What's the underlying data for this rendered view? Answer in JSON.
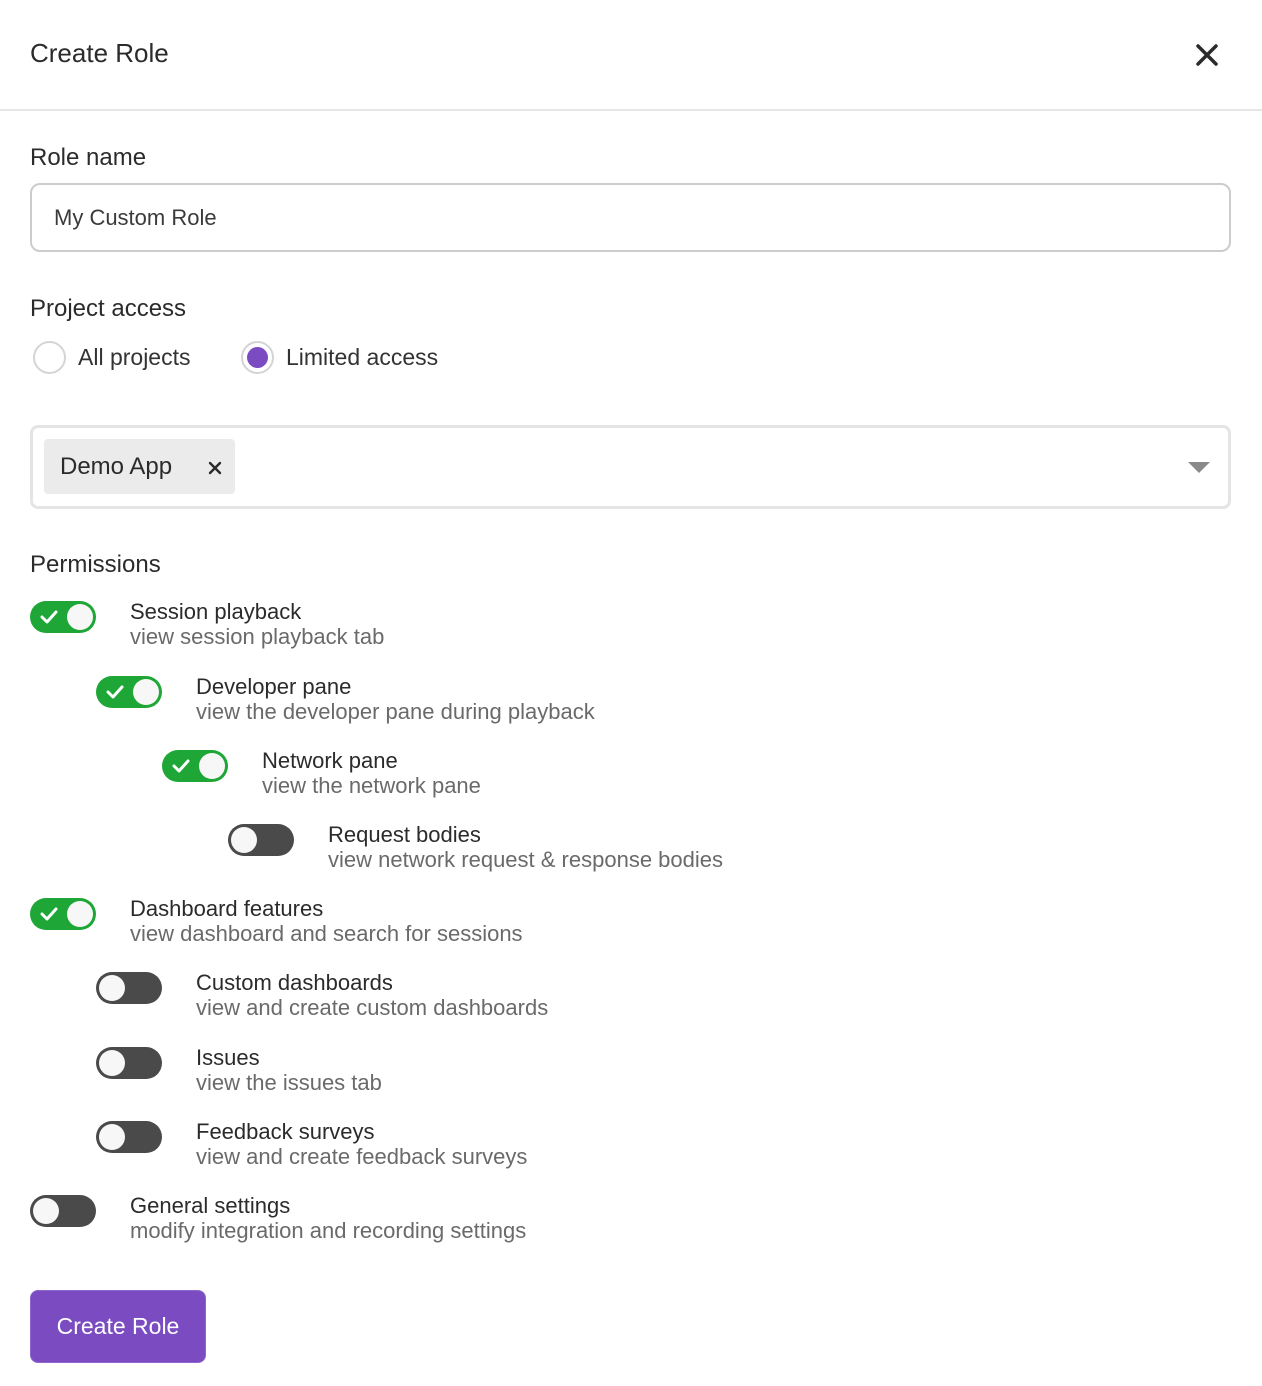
{
  "header": {
    "title": "Create Role",
    "close_icon": "close-icon"
  },
  "role_name": {
    "label": "Role name",
    "value": "My Custom Role"
  },
  "project_access": {
    "label": "Project access",
    "options": [
      {
        "label": "All projects",
        "selected": false
      },
      {
        "label": "Limited access",
        "selected": true
      }
    ],
    "selected_projects": [
      {
        "label": "Demo App",
        "remove_icon": "close-icon"
      }
    ],
    "dropdown_icon": "caret-down-icon"
  },
  "permissions": {
    "label": "Permissions",
    "items": [
      {
        "title": "Session playback",
        "description": "view session playback tab",
        "enabled": true,
        "level": 0
      },
      {
        "title": "Developer pane",
        "description": "view the developer pane during playback",
        "enabled": true,
        "level": 1
      },
      {
        "title": "Network pane",
        "description": "view the network pane",
        "enabled": true,
        "level": 2
      },
      {
        "title": "Request bodies",
        "description": "view network request & response bodies",
        "enabled": false,
        "level": 3
      },
      {
        "title": "Dashboard features",
        "description": "view dashboard and search for sessions",
        "enabled": true,
        "level": 0
      },
      {
        "title": "Custom dashboards",
        "description": "view and create custom dashboards",
        "enabled": false,
        "level": 1
      },
      {
        "title": "Issues",
        "description": "view the issues tab",
        "enabled": false,
        "level": 1
      },
      {
        "title": "Feedback surveys",
        "description": "view and create feedback surveys",
        "enabled": false,
        "level": 1
      },
      {
        "title": "General settings",
        "description": "modify integration and recording settings",
        "enabled": false,
        "level": 0
      }
    ]
  },
  "footer": {
    "submit_label": "Create Role"
  },
  "colors": {
    "accent": "#7a4bc1",
    "toggle_on": "#1ea736",
    "toggle_off": "#4a4a4a"
  }
}
